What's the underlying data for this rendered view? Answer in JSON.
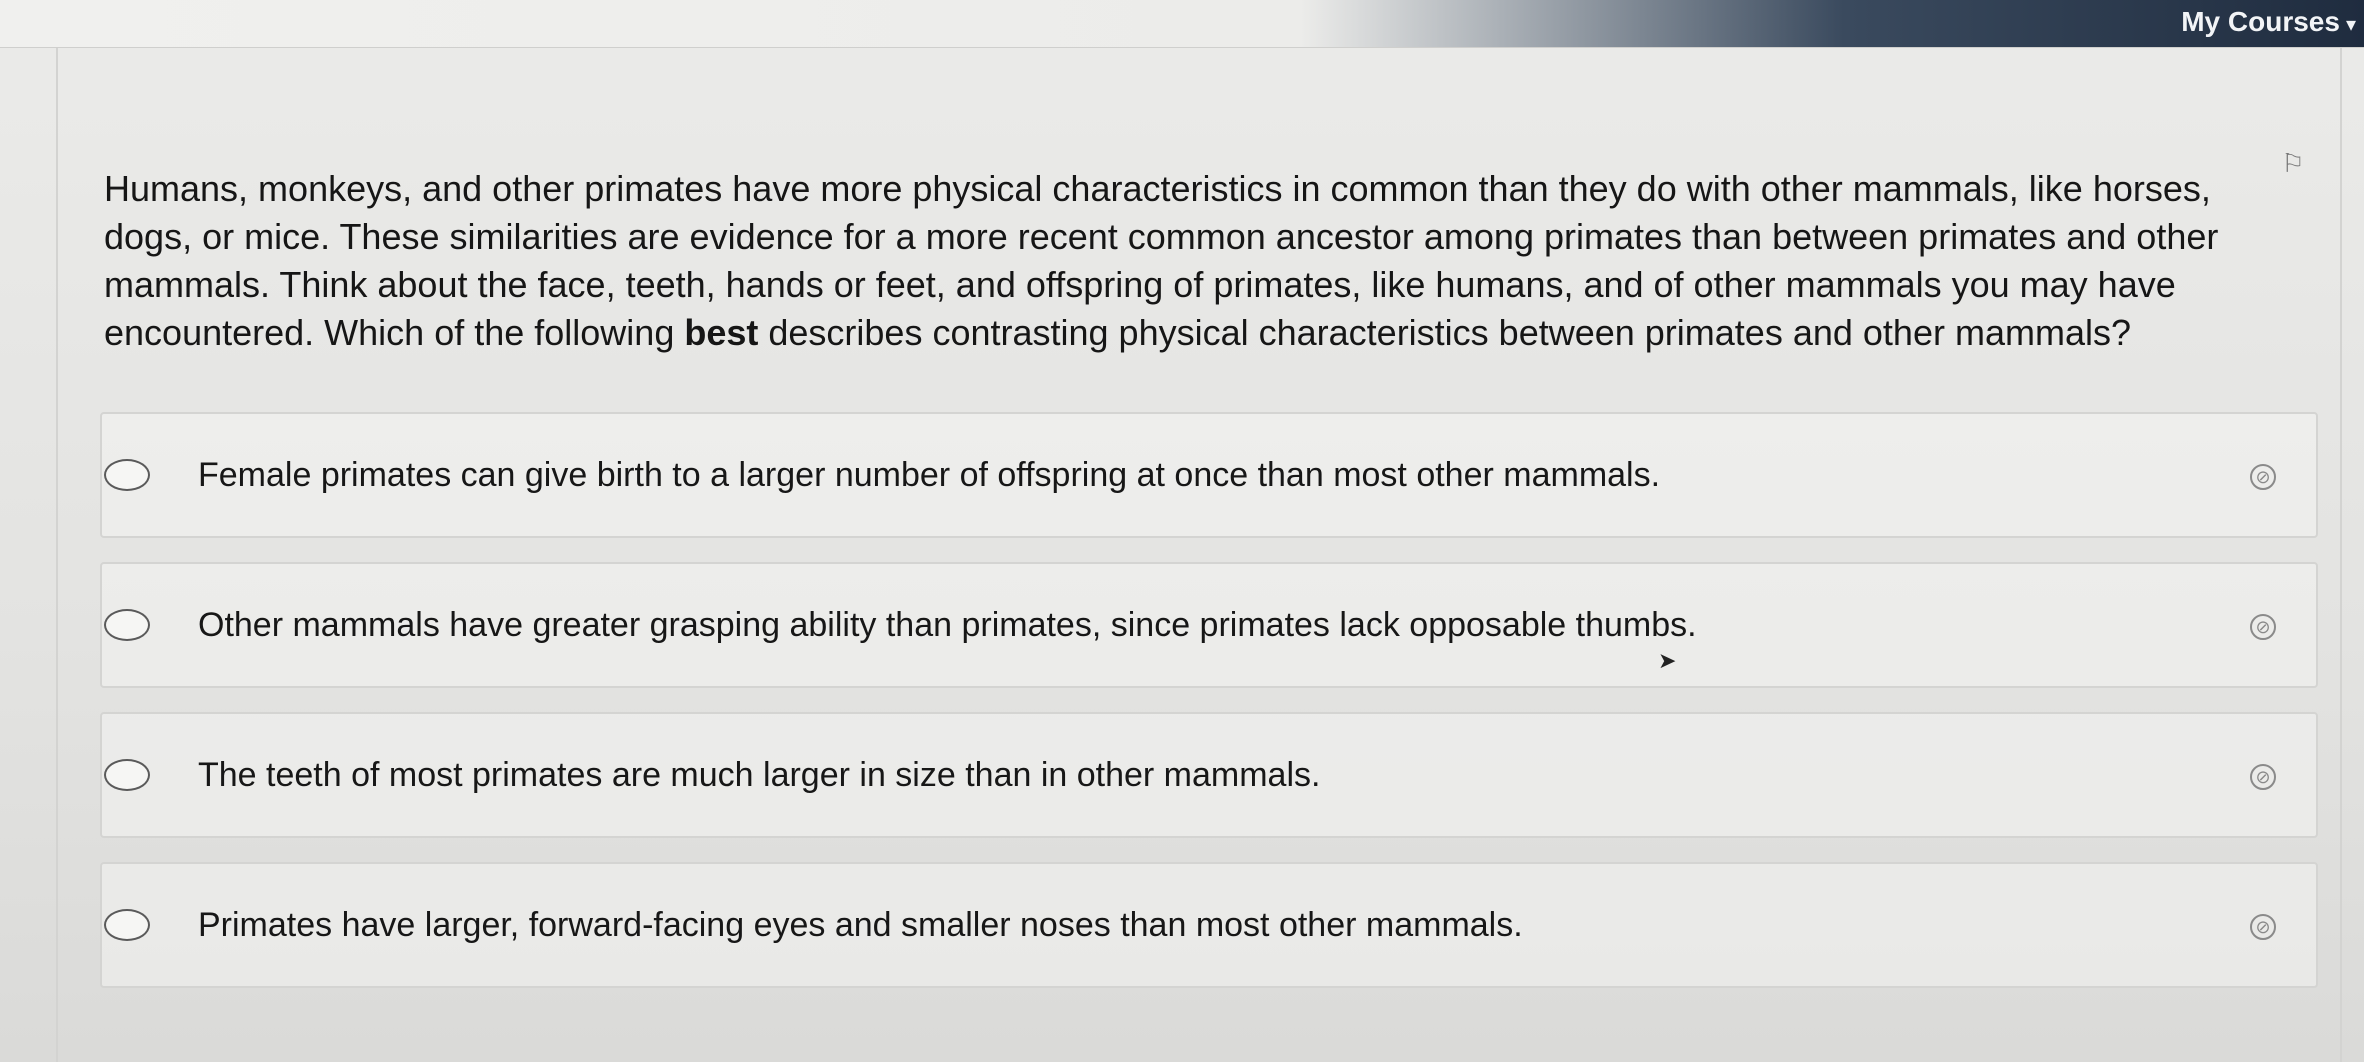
{
  "header": {
    "my_courses_label": "My Courses",
    "caret_icon": "▾"
  },
  "question": {
    "text_before_bold": "Humans, monkeys, and other primates have more physical characteristics in common than they do with other mammals, like horses, dogs, or mice. These similarities are evidence for a more recent common ancestor among primates than between primates and other mammals. Think about the face, teeth, hands or feet, and offspring of primates, like humans, and of other mammals you may have encountered. Which of the following ",
    "bold_word": "best",
    "text_after_bold": " describes contrasting physical characteristics between primates and other mammals?"
  },
  "choices": [
    {
      "label": "Female primates can give birth to a larger number of offspring at once than most other mammals."
    },
    {
      "label": "Other mammals have greater grasping ability than primates, since primates lack opposable thumbs."
    },
    {
      "label": "The teeth of most primates are much larger in size than in other mammals."
    },
    {
      "label": "Primates have larger, forward-facing eyes and smaller noses than most other mammals."
    }
  ],
  "icons": {
    "flag": "⚐",
    "strikethrough": "⊘",
    "cursor": "➤"
  }
}
